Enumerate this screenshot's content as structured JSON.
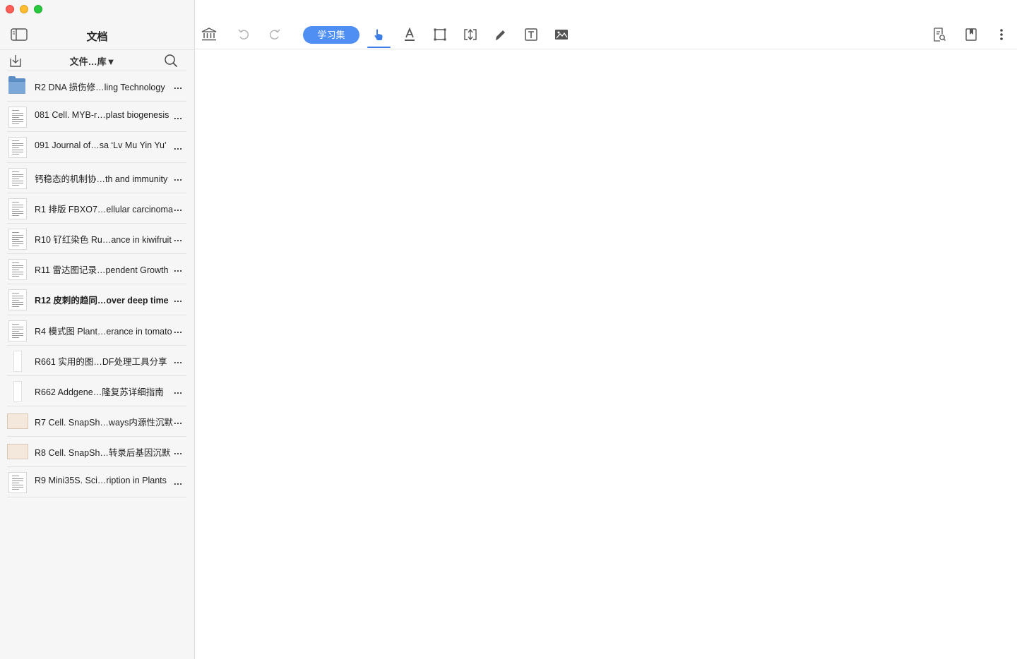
{
  "sidebar": {
    "title": "文档",
    "library_select": "文件…库▼",
    "documents": [
      {
        "title": "R2 DNA 损伤修…ling Technology",
        "thumb": "folder",
        "bold": false
      },
      {
        "title": "081 Cell. MYB-r…plast biogenesis",
        "thumb": "page",
        "bold": false
      },
      {
        "title": "091 Journal of…sa ‘Lv Mu Yin Yu’",
        "thumb": "page",
        "bold": false
      },
      {
        "title": "钙稳态的机制协…th and immunity",
        "thumb": "page",
        "bold": false
      },
      {
        "title": "R1 排版 FBXO7…ellular carcinoma",
        "thumb": "page",
        "bold": false
      },
      {
        "title": "R10 钌红染色 Ru…ance in kiwifruit",
        "thumb": "page",
        "bold": false
      },
      {
        "title": "R11 雷达图记录…pendent Growth",
        "thumb": "page",
        "bold": false
      },
      {
        "title": "R12 皮刺的趋同…over deep time",
        "thumb": "page",
        "bold": true
      },
      {
        "title": "R4 模式图 Plant…erance in tomato",
        "thumb": "page",
        "bold": false
      },
      {
        "title": "R661 实用的图…DF处理工具分享",
        "thumb": "narrow",
        "bold": false
      },
      {
        "title": "R662 Addgene…隆复苏详细指南",
        "thumb": "narrow",
        "bold": false
      },
      {
        "title": "R7 Cell. SnapSh…ways内源性沉默",
        "thumb": "wide",
        "bold": false
      },
      {
        "title": "R8 Cell. SnapSh…转录后基因沉默",
        "thumb": "wide",
        "bold": false
      },
      {
        "title": "R9 Mini35S. Sci…ription in Plants",
        "thumb": "page",
        "bold": false
      }
    ],
    "more_label": "..."
  },
  "toolbar": {
    "study_set_label": "学习集",
    "accent_color": "#4f8ef2",
    "icons": [
      "library-icon",
      "undo-icon",
      "redo-icon",
      "hand-pointer-icon",
      "text-highlight-icon",
      "rectangle-select-icon",
      "crop-icon",
      "pen-icon",
      "text-box-icon",
      "image-icon",
      "document-search-icon",
      "bookmark-icon",
      "more-vertical-icon"
    ]
  }
}
